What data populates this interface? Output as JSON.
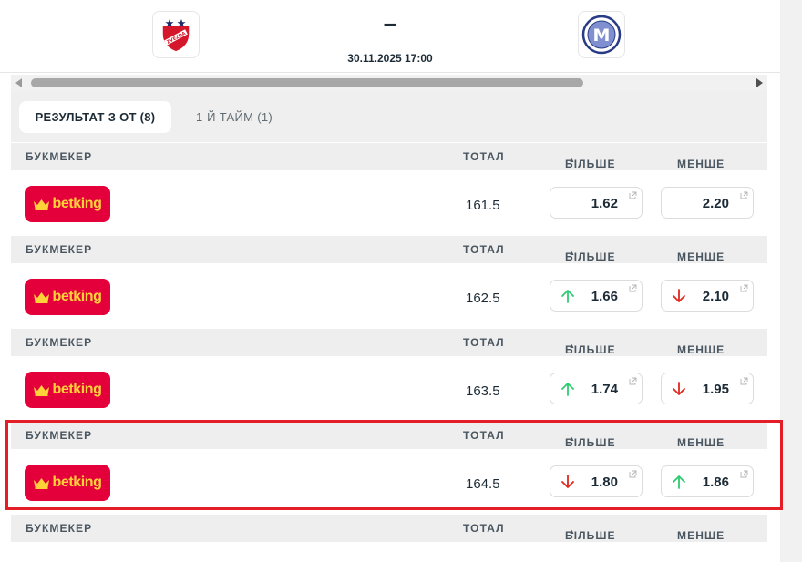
{
  "match": {
    "score": "–",
    "date": "30.11.2025 17:00",
    "home_logo_text": "ZVEZDA",
    "away_logo_text": "M"
  },
  "tabs": [
    {
      "label": "РЕЗУЛЬТАТ З ОТ (8)",
      "active": true
    },
    {
      "label": "1-Й ТАЙМ (1)",
      "active": false
    }
  ],
  "columns": {
    "bookmaker": "БУКМЕКЕР",
    "total": "ТОТАЛ",
    "over": "БІЛЬШЕ",
    "under": "МЕНШЕ"
  },
  "bookmaker_name": "betking",
  "rows": [
    {
      "total": "161.5",
      "over": "1.62",
      "over_trend": "none",
      "under": "2.20",
      "under_trend": "none"
    },
    {
      "total": "162.5",
      "over": "1.66",
      "over_trend": "up",
      "under": "2.10",
      "under_trend": "down"
    },
    {
      "total": "163.5",
      "over": "1.74",
      "over_trend": "up",
      "under": "1.95",
      "under_trend": "down"
    },
    {
      "total": "164.5",
      "over": "1.80",
      "over_trend": "down",
      "under": "1.86",
      "under_trend": "up"
    }
  ],
  "colors": {
    "brand_red": "#e4003a",
    "brand_yellow": "#ffd23a",
    "trend_up": "#2ecc71",
    "trend_down": "#e0281d",
    "highlight": "#e41e26"
  }
}
